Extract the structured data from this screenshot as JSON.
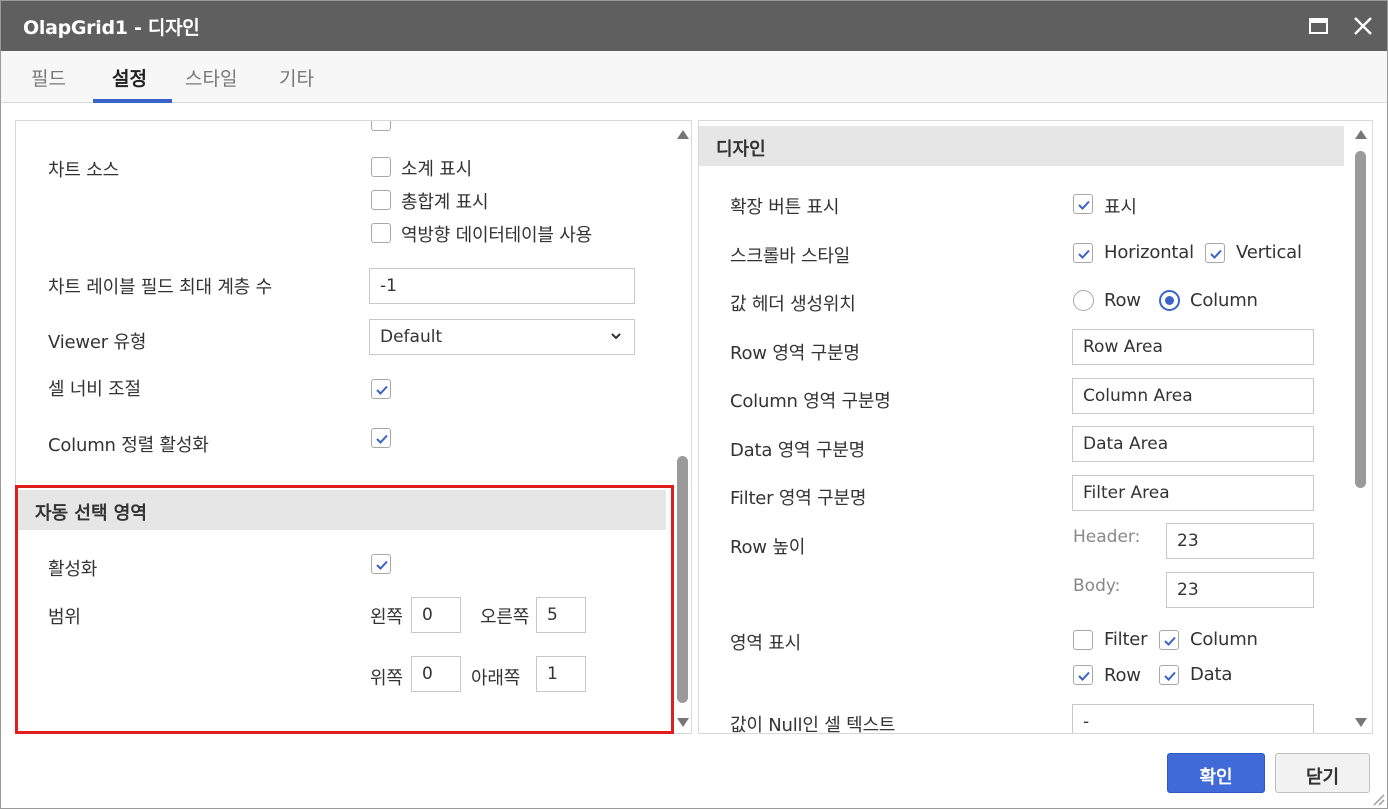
{
  "window": {
    "title": "OlapGrid1 - 디자인"
  },
  "tabs": [
    {
      "label": "필드"
    },
    {
      "label": "설정",
      "active": true
    },
    {
      "label": "스타일"
    },
    {
      "label": "기타"
    }
  ],
  "left": {
    "chart_source": {
      "label": "차트 소스",
      "options": [
        {
          "label": "소계 표시",
          "checked": false
        },
        {
          "label": "총합계 표시",
          "checked": false
        },
        {
          "label": "역방향 데이터테이블 사용",
          "checked": false
        }
      ]
    },
    "chart_label_depth": {
      "label": "차트 레이블 필드 최대 계층 수",
      "value": "-1"
    },
    "viewer_type": {
      "label": "Viewer 유형",
      "value": "Default"
    },
    "cell_width": {
      "label": "셀 너비 조절",
      "checked": true
    },
    "column_sort": {
      "label": "Column 정렬 활성화",
      "checked": true
    },
    "auto_select": {
      "title": "자동 선택 영역",
      "enable": {
        "label": "활성화",
        "checked": true
      },
      "range": {
        "label": "범위",
        "left_label": "왼쪽",
        "left_value": "0",
        "right_label": "오른쪽",
        "right_value": "5",
        "top_label": "위쪽",
        "top_value": "0",
        "bottom_label": "아래쪽",
        "bottom_value": "1"
      }
    }
  },
  "right": {
    "title": "디자인",
    "expand_button": {
      "label": "확장 버튼 표시",
      "option": "표시",
      "checked": true
    },
    "scrollbar_style": {
      "label": "스크롤바 스타일",
      "horizontal": "Horizontal",
      "vertical": "Vertical",
      "horizontal_checked": true,
      "vertical_checked": true
    },
    "value_header_pos": {
      "label": "값 헤더 생성위치",
      "row": "Row",
      "column": "Column",
      "selected": "Column"
    },
    "row_area_name": {
      "label": "Row 영역 구분명",
      "value": "Row Area"
    },
    "column_area_name": {
      "label": "Column 영역 구분명",
      "value": "Column Area"
    },
    "data_area_name": {
      "label": "Data 영역 구분명",
      "value": "Data Area"
    },
    "filter_area_name": {
      "label": "Filter 영역 구분명",
      "value": "Filter Area"
    },
    "row_height": {
      "label": "Row 높이",
      "header_label": "Header:",
      "header_value": "23",
      "body_label": "Body:",
      "body_value": "23"
    },
    "area_display": {
      "label": "영역 표시",
      "filter": "Filter",
      "column": "Column",
      "row": "Row",
      "data": "Data",
      "filter_checked": false,
      "column_checked": true,
      "row_checked": true,
      "data_checked": true
    },
    "null_text": {
      "label": "값이 Null인 셀 텍스트",
      "value": "-"
    }
  },
  "footer": {
    "ok_label": "확인",
    "close_label": "닫기"
  },
  "colors": {
    "titlebar": "#5f5f60",
    "accent": "#3f6ad8",
    "highlight": "#e01e1e"
  }
}
